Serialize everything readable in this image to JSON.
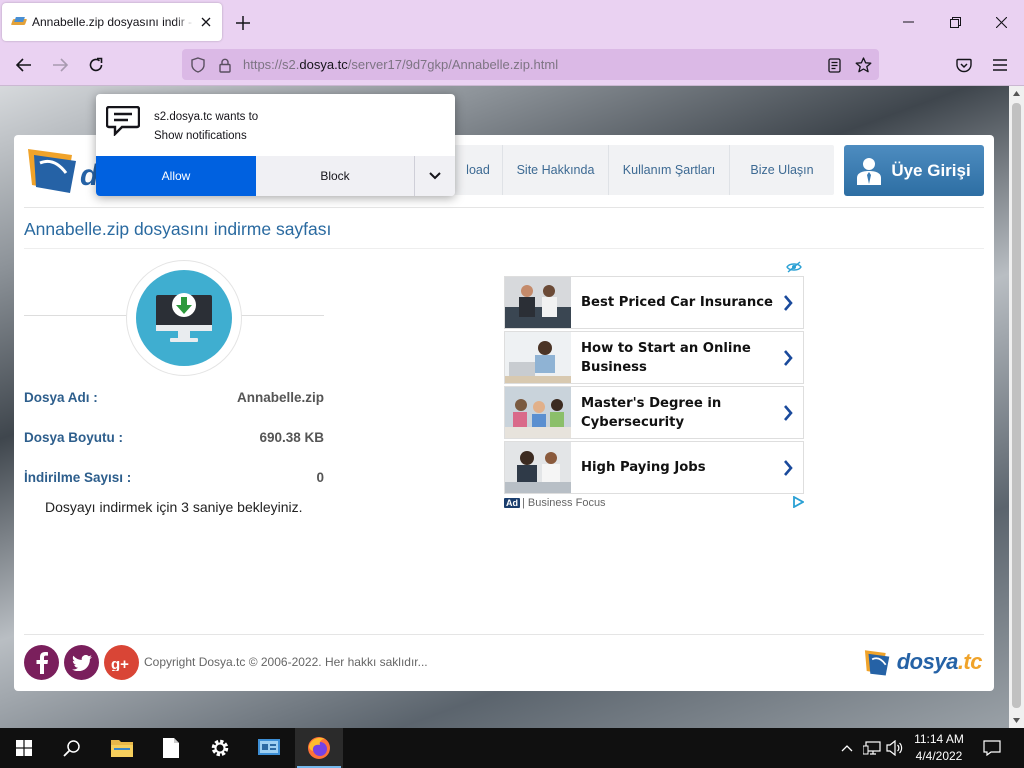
{
  "browser": {
    "tab_title": "Annabelle.zip dosyasını indir - dosya.tc",
    "url_prefix": "https://s2.",
    "url_domain": "dosya.tc",
    "url_path": "/server17/9d7gkp/Annabelle.zip.html"
  },
  "notification": {
    "line1": "s2.dosya.tc wants to",
    "line2": "Show notifications",
    "allow_label": "Allow",
    "block_label": "Block"
  },
  "site": {
    "menu": [
      "load",
      "Site Hakkında",
      "Kullanım Şartları",
      "Bize Ulaşın"
    ],
    "login_label": "Üye Girişi",
    "page_title": "Annabelle.zip dosyasını indirme sayfası",
    "file": {
      "name_label": "Dosya Adı :",
      "name_value": "Annabelle.zip",
      "size_label": "Dosya Boyutu :",
      "size_value": "690.38 KB",
      "downloads_label": "İndirilme Sayısı :",
      "downloads_value": "0"
    },
    "wait_message": "Dosyayı indirmek için 3 saniye bekleyiniz.",
    "copyright": "Copyright Dosya.tc © 2006-2022. Her hakkı saklıdır...",
    "logo_word_main": "dosya",
    "logo_word_ext": ".tc",
    "social": [
      "facebook",
      "twitter",
      "google-plus"
    ]
  },
  "ad": {
    "items": [
      {
        "line1": "Best Priced Car Insurance",
        "line2": ""
      },
      {
        "line1": "How to Start an Online",
        "line2": "Business"
      },
      {
        "line1": "Master's Degree in",
        "line2": "Cybersecurity"
      },
      {
        "line1": "High Paying Jobs",
        "line2": ""
      }
    ],
    "badge": "Ad",
    "source": "| Business Focus"
  },
  "taskbar": {
    "time": "11:14 AM",
    "date": "4/4/2022"
  },
  "colors": {
    "chrome": "#ead2f2",
    "accent_blue": "#2a6aa0",
    "allow_button": "#0061e0"
  }
}
